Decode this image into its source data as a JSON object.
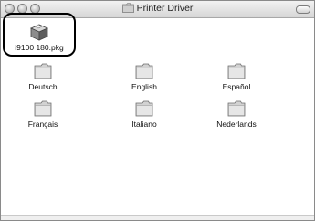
{
  "window": {
    "title": "Printer Driver"
  },
  "package": {
    "label": "i9100 180.pkg",
    "icon": "package-icon"
  },
  "folders": [
    {
      "label": "Deutsch",
      "icon": "folder-icon"
    },
    {
      "label": "English",
      "icon": "folder-icon"
    },
    {
      "label": "Español",
      "icon": "folder-icon"
    },
    {
      "label": "Français",
      "icon": "folder-icon"
    },
    {
      "label": "Italiano",
      "icon": "folder-icon"
    },
    {
      "label": "Nederlands",
      "icon": "folder-icon"
    }
  ],
  "colors": {
    "highlight_border": "#000000",
    "folder_body": "#cfcfcf"
  }
}
